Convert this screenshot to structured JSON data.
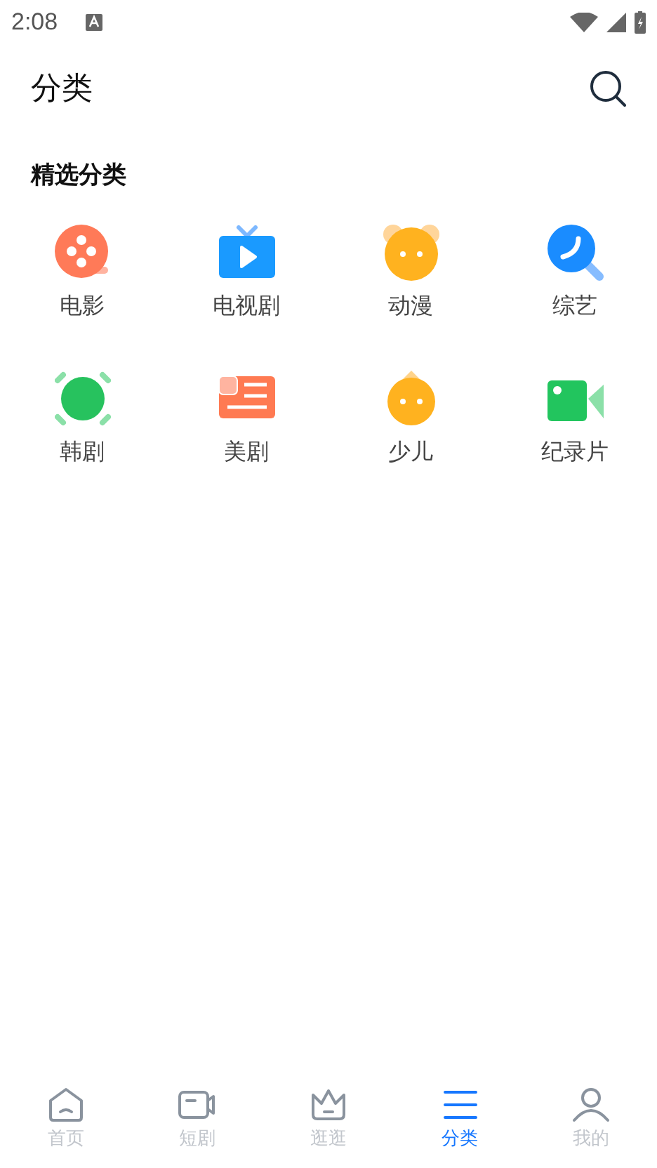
{
  "status_bar": {
    "time": "2:08"
  },
  "header": {
    "title": "分类"
  },
  "section": {
    "title": "精选分类"
  },
  "categories": [
    {
      "kind": "film",
      "label": "电影"
    },
    {
      "kind": "tv",
      "label": "电视剧"
    },
    {
      "kind": "anime",
      "label": "动漫"
    },
    {
      "kind": "variety",
      "label": "综艺"
    },
    {
      "kind": "korean",
      "label": "韩剧"
    },
    {
      "kind": "us",
      "label": "美剧"
    },
    {
      "kind": "kids",
      "label": "少儿"
    },
    {
      "kind": "documentary",
      "label": "纪录片"
    }
  ],
  "tabs": [
    {
      "kind": "home",
      "label": "首页",
      "selected": false
    },
    {
      "kind": "short",
      "label": "短剧",
      "selected": false
    },
    {
      "kind": "browse",
      "label": "逛逛",
      "selected": false
    },
    {
      "kind": "category",
      "label": "分类",
      "selected": true
    },
    {
      "kind": "profile",
      "label": "我的",
      "selected": false
    }
  ]
}
